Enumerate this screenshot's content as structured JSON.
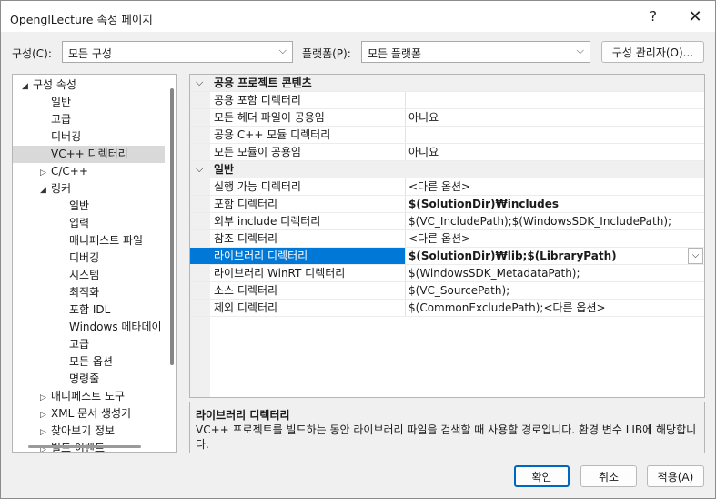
{
  "window": {
    "title": "OpenglLecture 속성 페이지",
    "help": "?",
    "close": "✕"
  },
  "toolbar": {
    "config_label": "구성(C):",
    "config_value": "모든 구성",
    "platform_label": "플랫폼(P):",
    "platform_value": "모든 플랫폼",
    "config_manager": "구성 관리자(O)..."
  },
  "tree": [
    {
      "label": "구성 속성",
      "level": 0,
      "exp": "◢"
    },
    {
      "label": "일반",
      "level": 1,
      "exp": ""
    },
    {
      "label": "고급",
      "level": 1,
      "exp": ""
    },
    {
      "label": "디버깅",
      "level": 1,
      "exp": ""
    },
    {
      "label": "VC++ 디렉터리",
      "level": 1,
      "exp": "",
      "selected": true
    },
    {
      "label": "C/C++",
      "level": 1,
      "exp": "▷"
    },
    {
      "label": "링커",
      "level": 1,
      "exp": "◢"
    },
    {
      "label": "일반",
      "level": 2,
      "exp": ""
    },
    {
      "label": "입력",
      "level": 2,
      "exp": ""
    },
    {
      "label": "매니페스트 파일",
      "level": 2,
      "exp": ""
    },
    {
      "label": "디버깅",
      "level": 2,
      "exp": ""
    },
    {
      "label": "시스템",
      "level": 2,
      "exp": ""
    },
    {
      "label": "최적화",
      "level": 2,
      "exp": ""
    },
    {
      "label": "포함 IDL",
      "level": 2,
      "exp": ""
    },
    {
      "label": "Windows 메타데이",
      "level": 2,
      "exp": ""
    },
    {
      "label": "고급",
      "level": 2,
      "exp": ""
    },
    {
      "label": "모든 옵션",
      "level": 2,
      "exp": ""
    },
    {
      "label": "명령줄",
      "level": 2,
      "exp": ""
    },
    {
      "label": "매니페스트 도구",
      "level": 1,
      "exp": "▷"
    },
    {
      "label": "XML 문서 생성기",
      "level": 1,
      "exp": "▷"
    },
    {
      "label": "찾아보기 정보",
      "level": 1,
      "exp": "▷"
    },
    {
      "label": "빌드 이벤트",
      "level": 1,
      "exp": "▷"
    }
  ],
  "grid": [
    {
      "category": true,
      "label": "공용 프로젝트 콘텐츠"
    },
    {
      "name": "공용 포함 디렉터리",
      "value": ""
    },
    {
      "name": "모든 헤더 파일이 공용임",
      "value": "아니요"
    },
    {
      "name": "공용 C++ 모듈 디렉터리",
      "value": ""
    },
    {
      "name": "모든 모듈이 공용임",
      "value": "아니요"
    },
    {
      "category": true,
      "label": "일반"
    },
    {
      "name": "실행 가능 디렉터리",
      "value": "<다른 옵션>"
    },
    {
      "name": "포함 디렉터리",
      "value": "$(SolutionDir)₩includes",
      "bold": true
    },
    {
      "name": "외부 include 디렉터리",
      "value": "$(VC_IncludePath);$(WindowsSDK_IncludePath);"
    },
    {
      "name": "참조 디렉터리",
      "value": "<다른 옵션>"
    },
    {
      "name": "라이브러리 디렉터리",
      "value": "$(SolutionDir)₩lib;$(LibraryPath)",
      "bold": true,
      "selected": true
    },
    {
      "name": "라이브러리 WinRT 디렉터리",
      "value": "$(WindowsSDK_MetadataPath);"
    },
    {
      "name": "소스 디렉터리",
      "value": "$(VC_SourcePath);"
    },
    {
      "name": "제외 디렉터리",
      "value": "$(CommonExcludePath);<다른 옵션>"
    }
  ],
  "description": {
    "title": "라이브러리 디렉터리",
    "text": "VC++ 프로젝트를 빌드하는 동안 라이브러리 파일을 검색할 때 사용할 경로입니다. 환경 변수 LIB에 해당합니다."
  },
  "buttons": {
    "ok": "확인",
    "cancel": "취소",
    "apply": "적용(A)"
  }
}
